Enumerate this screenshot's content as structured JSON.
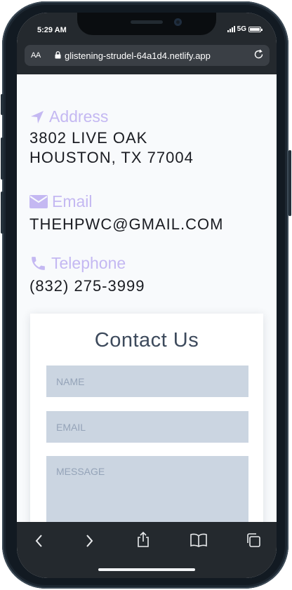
{
  "status_bar": {
    "time": "5:29 AM",
    "network": "5G"
  },
  "browser": {
    "text_size_label": "AA",
    "url": "glistening-strudel-64a1d4.netlify.app"
  },
  "address": {
    "label": "Address",
    "line1": "3802 LIVE OAK",
    "line2": "HOUSTON, TX 77004"
  },
  "email": {
    "label": "Email",
    "value": "THEHPWC@GMAIL.COM"
  },
  "telephone": {
    "label": "Telephone",
    "value": "(832) 275-3999"
  },
  "form": {
    "title": "Contact Us",
    "name_placeholder": "NAME",
    "email_placeholder": "EMAIL",
    "message_placeholder": "MESSAGE"
  },
  "colors": {
    "accent": "#c4b8f2",
    "field_bg": "#cbd5e1",
    "browser_chrome": "#24292e"
  }
}
